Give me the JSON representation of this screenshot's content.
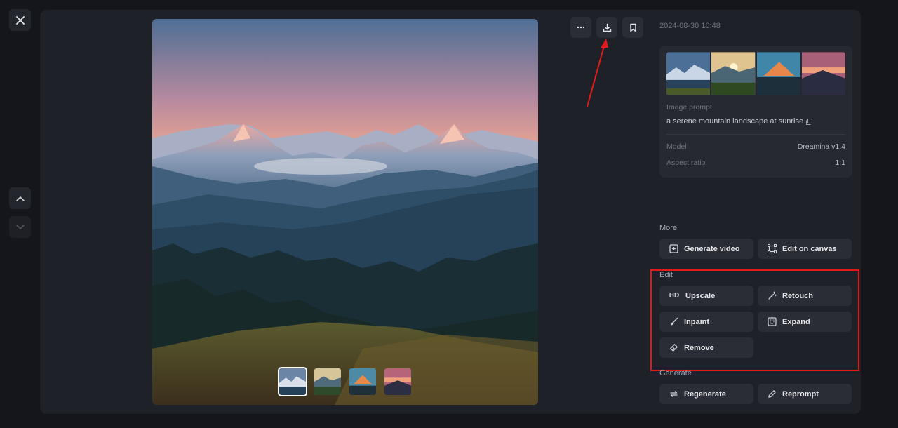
{
  "timestamp": "2024-08-30 16:48",
  "prompt": {
    "label": "Image prompt",
    "text": "a serene mountain landscape at sunrise"
  },
  "meta": [
    {
      "key": "Model",
      "value": "Dreamina v1.4"
    },
    {
      "key": "Aspect ratio",
      "value": "1:1"
    }
  ],
  "sections": {
    "more": "More",
    "edit": "Edit",
    "generate": "Generate"
  },
  "buttons": {
    "generate_video": "Generate video",
    "edit_on_canvas": "Edit on canvas",
    "upscale": "Upscale",
    "upscale_badge": "HD",
    "retouch": "Retouch",
    "inpaint": "Inpaint",
    "expand": "Expand",
    "remove": "Remove",
    "regenerate": "Regenerate",
    "reprompt": "Reprompt"
  },
  "toolbar": {
    "more_icon": "ellipsis-icon",
    "download_icon": "download-icon",
    "bookmark_icon": "bookmark-icon"
  },
  "thumbnails": [
    "thumb-1",
    "thumb-2",
    "thumb-3",
    "thumb-4"
  ],
  "active_thumbnail": 1,
  "colors": {
    "panel": "#1f2128",
    "button": "#2a2d35",
    "annotation": "#e11a1a"
  }
}
